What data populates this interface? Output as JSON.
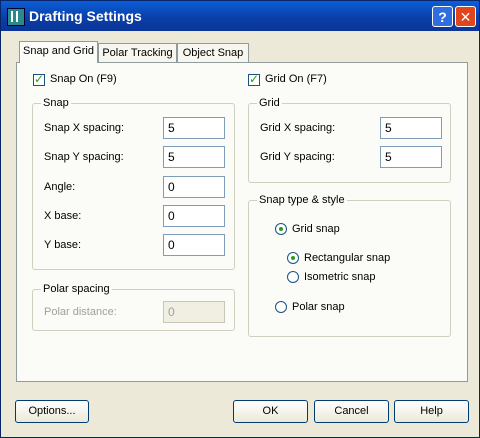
{
  "window": {
    "title": "Drafting Settings",
    "help_glyph": "?",
    "close_glyph": "✕"
  },
  "tabs": [
    {
      "label": "Snap and Grid",
      "active": true
    },
    {
      "label": "Polar Tracking",
      "active": false
    },
    {
      "label": "Object Snap",
      "active": false
    }
  ],
  "snap_on": {
    "label": "Snap On (F9)",
    "checked": true
  },
  "grid_on": {
    "label": "Grid On (F7)",
    "checked": true
  },
  "snap_group": {
    "legend": "Snap",
    "fields": [
      {
        "label": "Snap X spacing:",
        "value": "5"
      },
      {
        "label": "Snap Y spacing:",
        "value": "5"
      },
      {
        "label": "Angle:",
        "value": "0"
      },
      {
        "label": "X base:",
        "value": "0"
      },
      {
        "label": "Y base:",
        "value": "0"
      }
    ]
  },
  "polar_group": {
    "legend": "Polar spacing",
    "field": {
      "label": "Polar distance:",
      "value": "0",
      "disabled": true
    }
  },
  "grid_group": {
    "legend": "Grid",
    "fields": [
      {
        "label": "Grid X spacing:",
        "value": "5"
      },
      {
        "label": "Grid Y spacing:",
        "value": "5"
      }
    ]
  },
  "snap_type_group": {
    "legend": "Snap type & style",
    "grid_snap": {
      "label": "Grid snap",
      "selected": true
    },
    "rectangular_snap": {
      "label": "Rectangular snap",
      "selected": true
    },
    "isometric_snap": {
      "label": "Isometric snap",
      "selected": false
    },
    "polar_snap": {
      "label": "Polar snap",
      "selected": false
    }
  },
  "buttons": {
    "options": "Options...",
    "ok": "OK",
    "cancel": "Cancel",
    "help": "Help"
  },
  "colors": {
    "title_bar": "#0a4fc0",
    "close_button": "#e0451b",
    "check_mark": "#21a121",
    "panel_bg": "#fbfbf8"
  }
}
